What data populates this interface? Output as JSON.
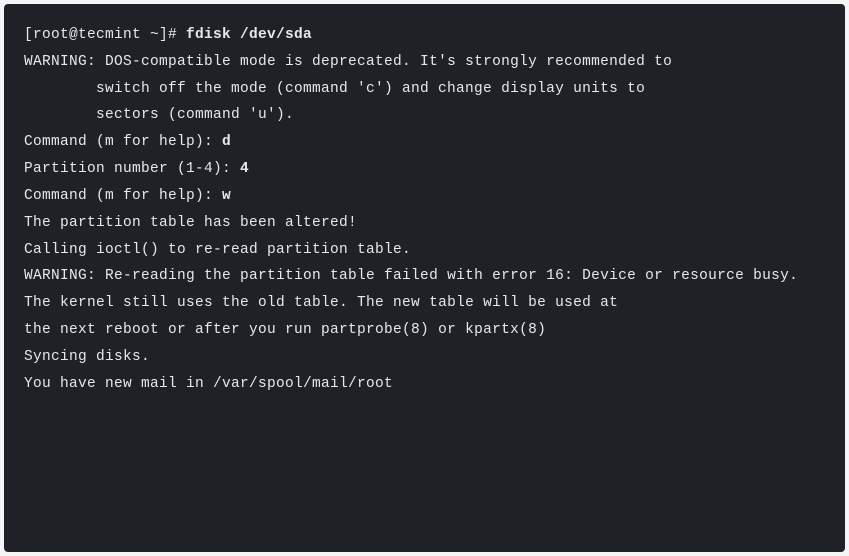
{
  "terminal": {
    "prompt": "[root@tecmint ~]# ",
    "command": "fdisk /dev/sda",
    "blank": "",
    "warn1a": "WARNING: DOS-compatible mode is deprecated. It's strongly recommended to",
    "warn1b": "switch off the mode (command 'c') and change display units to",
    "warn1c": "sectors (command 'u').",
    "cmd_prompt1": "Command (m for help): ",
    "cmd_val1": "d",
    "part_prompt": "Partition number (1-4): ",
    "part_val": "4",
    "cmd_prompt2": "Command (m for help): ",
    "cmd_val2": "w",
    "altered": "The partition table has been altered!",
    "ioctl": "Calling ioctl() to re-read partition table.",
    "warn2a": "WARNING: Re-reading the partition table failed with error 16: Device or resource busy.",
    "warn2b": "The kernel still uses the old table. The new table will be used at",
    "warn2c": "the next reboot or after you run partprobe(8) or kpartx(8)",
    "sync": "Syncing disks.",
    "mail": "You have new mail in /var/spool/mail/root"
  }
}
